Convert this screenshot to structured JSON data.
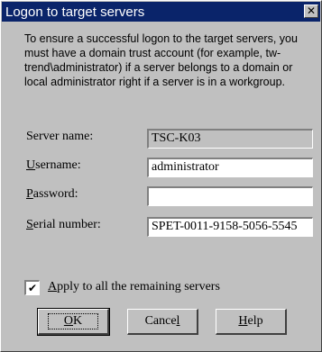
{
  "window": {
    "title": "Logon to target servers",
    "close_glyph": "✕"
  },
  "instructions": "To ensure a successful logon to the target servers, you must have a domain trust account (for example, tw-trend\\administrator) if a server belongs to a domain or local administrator right if a server is in a workgroup.",
  "fields": {
    "server_name": {
      "label": "Server name:",
      "value": "TSC-K03"
    },
    "username": {
      "label_mnemonic": "U",
      "label_rest": "sername:",
      "value": "administrator"
    },
    "password": {
      "label_mnemonic": "P",
      "label_rest": "assword:",
      "value": ""
    },
    "serial_number": {
      "label_mnemonic": "S",
      "label_rest": "erial number:",
      "value": "SPET-0011-9158-5056-5545"
    }
  },
  "apply_all": {
    "checked": true,
    "check_glyph": "✔",
    "label_mnemonic": "A",
    "label_rest": "pply to all the remaining servers"
  },
  "buttons": {
    "ok": {
      "mnemonic": "O",
      "rest": "K"
    },
    "cancel": {
      "pre": "Cance",
      "mnemonic": "l"
    },
    "help": {
      "mnemonic": "H",
      "rest": "elp"
    }
  }
}
